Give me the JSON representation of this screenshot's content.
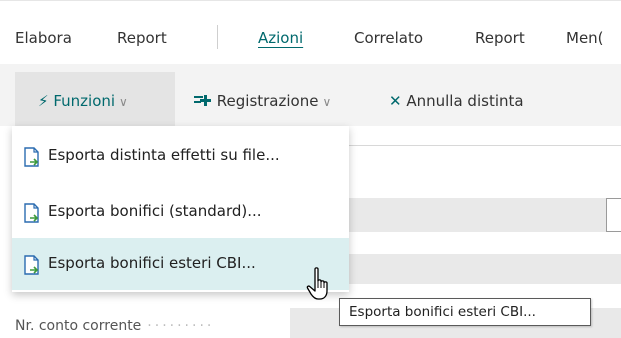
{
  "topnav": {
    "items": [
      {
        "label": "Elabora"
      },
      {
        "label": "Report"
      },
      {
        "label": "Azioni"
      },
      {
        "label": "Correlato"
      },
      {
        "label": "Report"
      },
      {
        "label": "Men("
      }
    ]
  },
  "actionbar": {
    "funzioni_label": "Funzioni",
    "registrazione_label": "Registrazione",
    "annulla_label": "Annulla distinta"
  },
  "menu": {
    "items": [
      {
        "label": "Esporta distinta effetti su file..."
      },
      {
        "label": "Esporta bonifici (standard)..."
      },
      {
        "label": "Esporta bonifici esteri CBI..."
      }
    ]
  },
  "tooltip": {
    "text": "Esporta bonifici esteri CBI..."
  },
  "form": {
    "field_label": "Nr. conto corrente"
  },
  "colors": {
    "accent": "#00696d",
    "hover": "#dbeff0",
    "icon_blue": "#2b6cb0",
    "icon_green": "#3c9a3c"
  }
}
